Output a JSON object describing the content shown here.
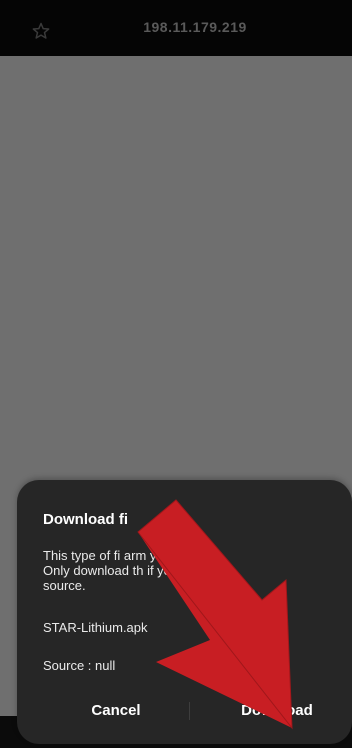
{
  "browser": {
    "url": "198.11.179.219",
    "icons": {
      "bookmark": "star-outline-icon"
    }
  },
  "dialog": {
    "title": "Download fi",
    "message_line1": "This type of fi       arm your phone.",
    "message_line2": "Only download th      if you trust its",
    "message_line3": "source.",
    "file_name": "STAR-Lithium.apk",
    "source": "Source  : null",
    "cancel_label": "Cancel",
    "download_label": "Download"
  },
  "overlay": {
    "arrow_color": "#c81e23",
    "arrow_icon": "red-arrow-icon"
  },
  "colors": {
    "topbar_bg": "#050505",
    "content_bg": "#6f6f6f",
    "dialog_bg": "#262626",
    "text": "#ffffff"
  }
}
